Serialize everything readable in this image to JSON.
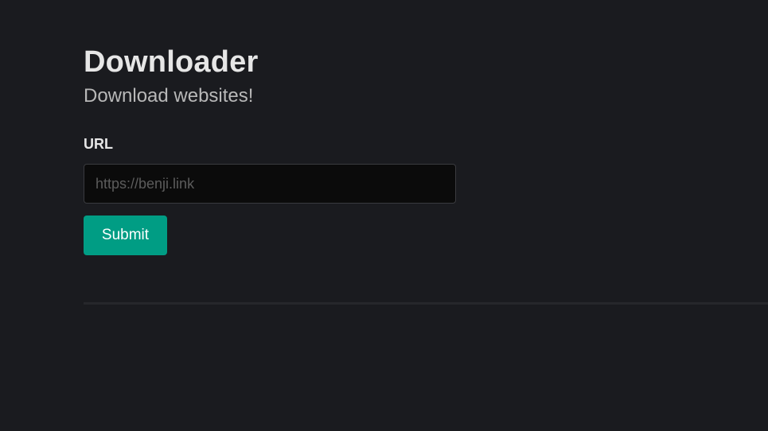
{
  "header": {
    "title": "Downloader",
    "subtitle": "Download websites!"
  },
  "form": {
    "url_label": "URL",
    "url_value": "",
    "url_placeholder": "https://benji.link",
    "submit_label": "Submit"
  },
  "colors": {
    "background": "#1a1b1f",
    "accent": "#009d84",
    "input_background": "#0b0b0b"
  }
}
